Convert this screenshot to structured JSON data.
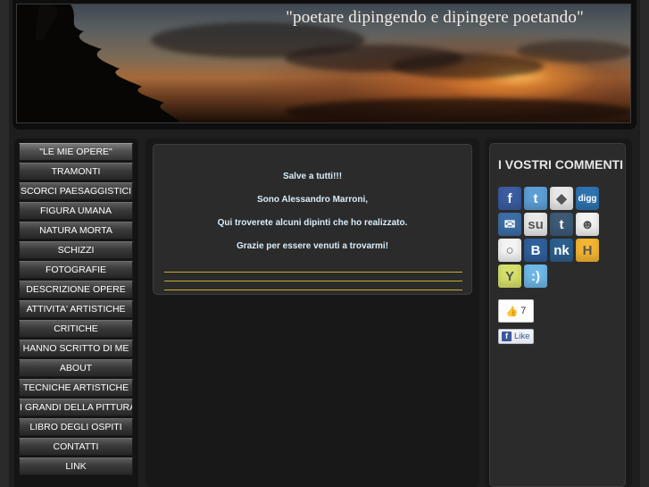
{
  "header": {
    "motto": "\"poetare dipingendo e dipingere poetando\""
  },
  "nav": {
    "items": [
      {
        "label": "\"LE MIE OPERE\"",
        "active": true
      },
      {
        "label": "TRAMONTI"
      },
      {
        "label": "SCORCI PAESAGGISTICI"
      },
      {
        "label": "FIGURA UMANA"
      },
      {
        "label": "NATURA MORTA"
      },
      {
        "label": "SCHIZZI"
      },
      {
        "label": "FOTOGRAFIE"
      },
      {
        "label": "DESCRIZIONE OPERE"
      },
      {
        "label": "ATTIVITA' ARTISTICHE"
      },
      {
        "label": "CRITICHE"
      },
      {
        "label": "HANNO SCRITTO DI ME"
      },
      {
        "label": "ABOUT"
      },
      {
        "label": "TECNICHE ARTISTICHE"
      },
      {
        "label": "I GRANDI DELLA PITTURA"
      },
      {
        "label": "LIBRO DEGLI OSPITI"
      },
      {
        "label": "CONTATTI"
      },
      {
        "label": "LINK"
      }
    ]
  },
  "main": {
    "lines": [
      "Salve a tutti!!!",
      "Sono Alessandro Marroni,",
      "Qui troverete alcuni dipinti che ho realizzato.",
      "Grazie per essere venuti a trovarmi!"
    ]
  },
  "sidebar": {
    "title": "I VOSTRI COMMENTI",
    "share_icons": [
      {
        "name": "facebook-icon",
        "glyph": "f",
        "color": "#3b5ca0"
      },
      {
        "name": "twitter-icon",
        "glyph": "t",
        "color": "#5d9fd4"
      },
      {
        "name": "google-bookmarks-icon",
        "glyph": "◆",
        "color": "#e8e8e8"
      },
      {
        "name": "digg-icon",
        "glyph": "digg",
        "color": "#2e72b0"
      },
      {
        "name": "email-icon",
        "glyph": "✉",
        "color": "#3c6ea5"
      },
      {
        "name": "stumbleupon-icon",
        "glyph": "su",
        "color": "#e9e9e9"
      },
      {
        "name": "tumblr-icon",
        "glyph": "t",
        "color": "#3d5a77"
      },
      {
        "name": "reddit-icon",
        "glyph": "☻",
        "color": "#f2f2f2"
      },
      {
        "name": "myspace-icon",
        "glyph": "○",
        "color": "#f3f3f3"
      },
      {
        "name": "blogger-icon",
        "glyph": "B",
        "color": "#2f5f9c"
      },
      {
        "name": "netvibes-icon",
        "glyph": "nk",
        "color": "#2c5f8d"
      },
      {
        "name": "hyves-icon",
        "glyph": "H",
        "color": "#f4b531"
      },
      {
        "name": "yahoo-buzz-icon",
        "glyph": "Y",
        "color": "#d5e06a"
      },
      {
        "name": "chat-icon",
        "glyph": ":)",
        "color": "#6eb7e6"
      }
    ],
    "like_count": "7",
    "like_label": "Like"
  }
}
